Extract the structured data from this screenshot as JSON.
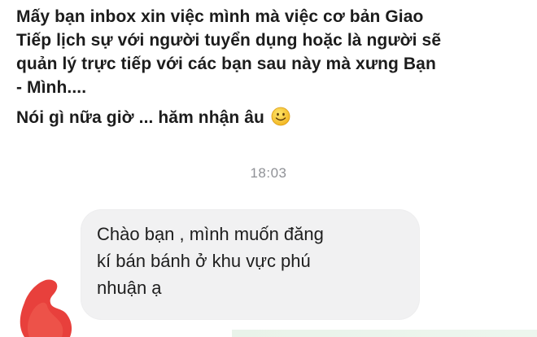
{
  "post": {
    "lines": [
      "Mấy bạn inbox xin việc mình mà việc cơ bản Giao",
      "Tiếp lịch sự với người tuyển dụng hoặc là người sẽ",
      "quản lý trực tiếp với các bạn sau này mà xưng Bạn",
      "- Mình....",
      "Nói gì nữa giờ ... hăm nhận âu"
    ],
    "emoji": "smiling-face-icon"
  },
  "conversation": {
    "timestamp": "18:03",
    "message": {
      "lines": [
        "Chào bạn , mình muốn đăng",
        "kí bán bánh ở khu vực phú",
        "nhuận ạ"
      ]
    },
    "avatar": "redacted-avatar"
  },
  "colors": {
    "bubble": "#f1f1f2",
    "timestamp": "#8f9196",
    "redaction": "#e8403c",
    "emoji": "#f7c531"
  }
}
